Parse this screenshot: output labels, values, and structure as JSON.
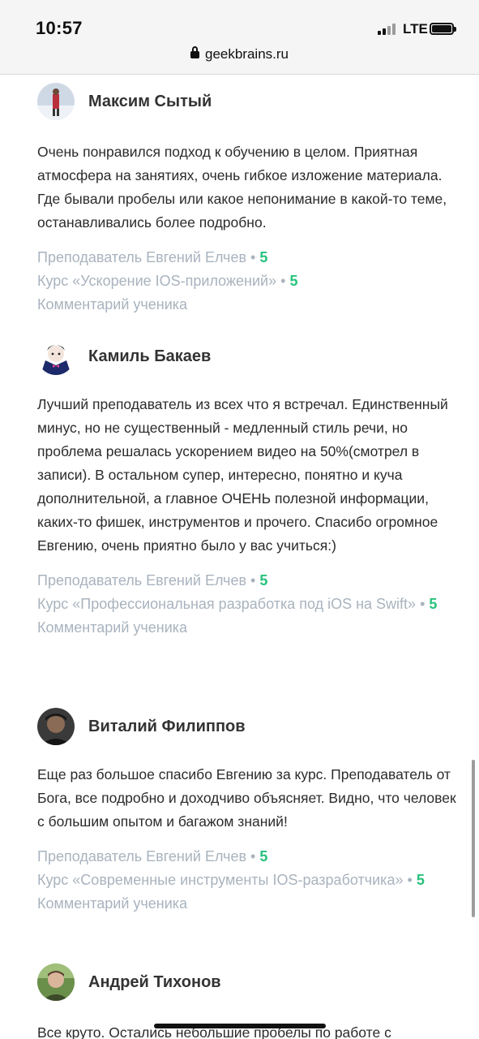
{
  "status_bar": {
    "time": "10:57",
    "network": "LTE"
  },
  "browser": {
    "domain": "geekbrains.ru"
  },
  "reviews": [
    {
      "name": "Максим Сытый",
      "text": "Очень понравился подход к обучению в целом. Приятная атмосфера на занятиях, очень гибкое изложение материала. Где бывали пробелы или какое непонимание в какой-то теме, останавливались более подробно.",
      "teacher_label": "Преподаватель Евгений Елчев",
      "teacher_rating": "5",
      "course_label": "Курс «Ускорение IOS-приложений»",
      "course_rating": "5",
      "comment_label": "Комментарий ученика"
    },
    {
      "name": "Камиль Бакаев",
      "text": "Лучший преподаватель из всех что я встречал. Единственный минус, но не существенный - медленный стиль речи, но проблема решалась ускорением видео на 50%(смотрел в записи). В остальном супер, интересно, понятно и куча дополнительной, а главное ОЧЕНЬ полезной информации, каких-то фишек, инструментов и прочего. Спасибо огромное Евгению, очень приятно было у вас учиться:)",
      "teacher_label": "Преподаватель Евгений Елчев",
      "teacher_rating": "5",
      "course_label": "Курс «Профессиональная разработка под iOS на Swift»",
      "course_rating": "5",
      "comment_label": "Комментарий ученика"
    },
    {
      "name": "Виталий Филиппов",
      "text": "Еще раз большое спасибо Евгению за курс. Преподаватель от Бога, все подробно и доходчиво объясняет. Видно, что человек с большим опытом и багажом знаний!",
      "teacher_label": "Преподаватель Евгений Елчев",
      "teacher_rating": "5",
      "course_label": "Курс «Современные инструменты IOS-разработчика»",
      "course_rating": "5",
      "comment_label": "Комментарий ученика"
    },
    {
      "name": "Андрей Тихонов",
      "text": "Все круто. Остались небольшие пробелы по работе с"
    }
  ]
}
